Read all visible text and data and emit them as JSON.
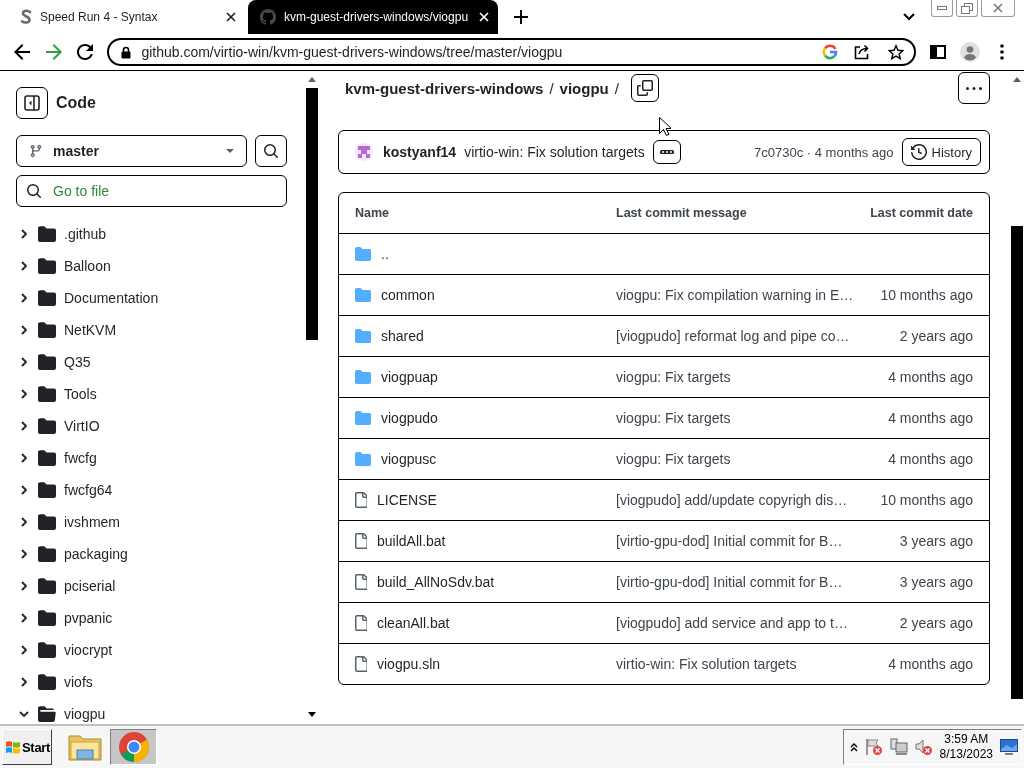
{
  "browser": {
    "tabs": [
      {
        "kind": "s-logo",
        "title": "Speed Run 4 - Syntax",
        "selected": false
      },
      {
        "kind": "cat-logo",
        "title": "kvm-guest-drivers-windows/viogpu",
        "selected": true
      }
    ],
    "address": "github.com/virtio-win/kvm-guest-drivers-windows/tree/master/viogpu"
  },
  "sidebar": {
    "title": "Code",
    "branch": "master",
    "file_search": {
      "placeholder": "Go to file"
    },
    "tree": [
      {
        "name": ".github",
        "expanded": false
      },
      {
        "name": "Balloon",
        "expanded": false
      },
      {
        "name": "Documentation",
        "expanded": false
      },
      {
        "name": "NetKVM",
        "expanded": false
      },
      {
        "name": "Q35",
        "expanded": false
      },
      {
        "name": "Tools",
        "expanded": false
      },
      {
        "name": "VirtIO",
        "expanded": false
      },
      {
        "name": "fwcfg",
        "expanded": false
      },
      {
        "name": "fwcfg64",
        "expanded": false
      },
      {
        "name": "ivshmem",
        "expanded": false
      },
      {
        "name": "packaging",
        "expanded": false
      },
      {
        "name": "pciserial",
        "expanded": false
      },
      {
        "name": "pvpanic",
        "expanded": false
      },
      {
        "name": "viocrypt",
        "expanded": false
      },
      {
        "name": "viofs",
        "expanded": false
      },
      {
        "name": "viogpu",
        "expanded": true
      }
    ]
  },
  "breadcrumb": [
    {
      "kind": "link",
      "text": "kvm-guest-drivers-windows"
    },
    {
      "kind": "separator",
      "text": "/"
    },
    {
      "kind": "current",
      "text": "viogpu"
    },
    {
      "kind": "separator",
      "text": "/"
    }
  ],
  "latest_commit": {
    "author": "kostyanf14",
    "message": "virtio-win: Fix solution targets",
    "sha_age": "7c0730c · 4 months ago",
    "history_button": "History"
  },
  "file_table": {
    "columns": [
      "Name",
      "Last commit message",
      "Last commit date"
    ],
    "rows": [
      {
        "kind": "parent",
        "name": ".."
      },
      {
        "kind": "folder",
        "name": "common",
        "message": "viogpu: Fix compilation warning in E…",
        "date": "10 months ago"
      },
      {
        "kind": "folder",
        "name": "shared",
        "message": "[viogpudo] reformat log and pipe co…",
        "date": "2 years ago"
      },
      {
        "kind": "folder",
        "name": "viogpuap",
        "message": "viogpu: Fix targets",
        "date": "4 months ago"
      },
      {
        "kind": "folder",
        "name": "viogpudo",
        "message": "viogpu: Fix targets",
        "date": "4 months ago"
      },
      {
        "kind": "folder",
        "name": "viogpusc",
        "message": "viogpu: Fix targets",
        "date": "4 months ago"
      },
      {
        "kind": "file",
        "name": "LICENSE",
        "message": "[viogpudo] add/update copyrigh dis…",
        "date": "10 months ago"
      },
      {
        "kind": "file",
        "name": "buildAll.bat",
        "message": "[virtio-gpu-dod] Initial commit for B…",
        "date": "3 years ago"
      },
      {
        "kind": "file",
        "name": "build_AllNoSdv.bat",
        "message": "[virtio-gpu-dod] Initial commit for B…",
        "date": "3 years ago"
      },
      {
        "kind": "file",
        "name": "cleanAll.bat",
        "message": "[viogpudo] add service and app to t…",
        "date": "2 years ago"
      },
      {
        "kind": "file",
        "name": "viogpu.sln",
        "message": "virtio-win: Fix solution targets",
        "date": "4 months ago"
      }
    ]
  },
  "taskbar": {
    "start": "Start",
    "apps": [
      {
        "kind": "folder",
        "selected": false
      },
      {
        "kind": "browser",
        "selected": true
      }
    ],
    "clock": {
      "time": "3:59 AM",
      "date": "8/13/2023"
    }
  }
}
